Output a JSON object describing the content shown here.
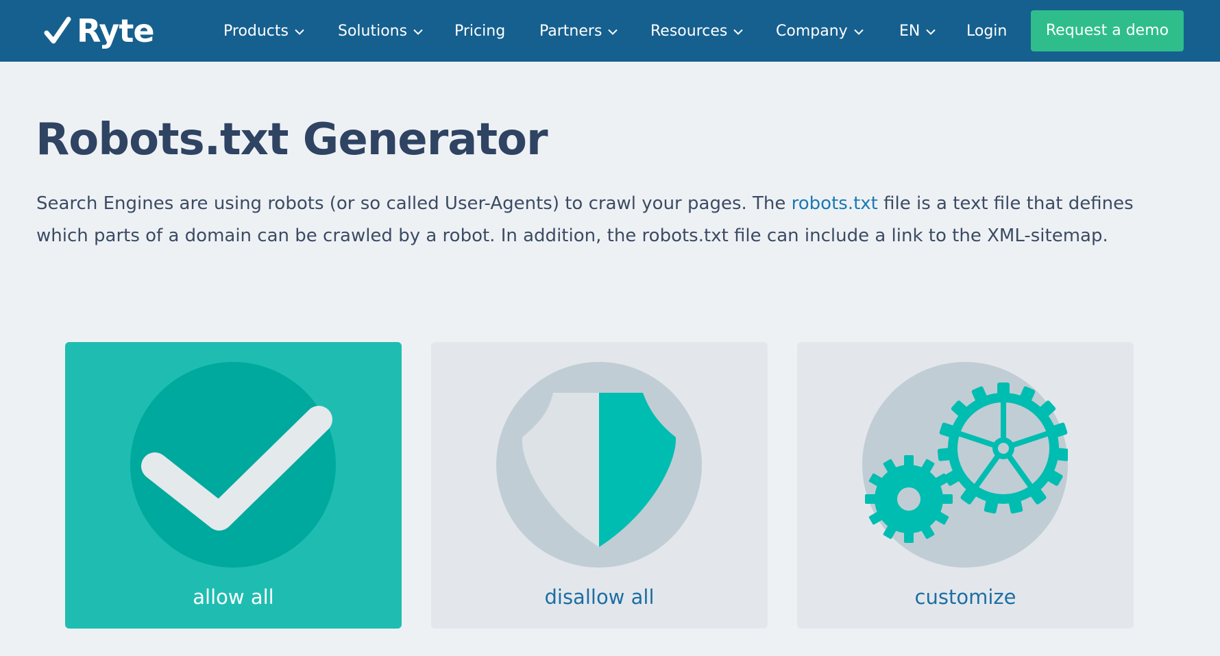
{
  "brand": {
    "name": "Ryte",
    "logo_icon": "checkmark-logo-icon"
  },
  "nav": {
    "items": [
      {
        "label": "Products",
        "has_dropdown": true
      },
      {
        "label": "Solutions",
        "has_dropdown": true
      },
      {
        "label": "Pricing",
        "has_dropdown": false
      },
      {
        "label": "Partners",
        "has_dropdown": true
      },
      {
        "label": "Resources",
        "has_dropdown": true
      },
      {
        "label": "Company",
        "has_dropdown": true
      },
      {
        "label": "EN",
        "has_dropdown": true
      },
      {
        "label": "Login",
        "has_dropdown": false
      }
    ],
    "cta_label": "Request a demo"
  },
  "page": {
    "title": "Robots.txt Generator",
    "intro_before_link": "Search Engines are using robots (or so called User-Agents) to crawl your pages. The ",
    "intro_link": "robots.txt",
    "intro_after_link": " file is a text file that defines which parts of a domain can be crawled by a robot. In addition, the robots.txt file can include a link to the XML-sitemap."
  },
  "options": [
    {
      "label": "allow all",
      "icon": "checkmark-circle-icon",
      "selected": true
    },
    {
      "label": "disallow all",
      "icon": "shield-icon",
      "selected": false
    },
    {
      "label": "customize",
      "icon": "gears-icon",
      "selected": false
    }
  ],
  "colors": {
    "nav_background": "#16608f",
    "cta_background": "#2fbe8b",
    "page_background": "#eef1f4",
    "selected_card": "#1fbdb1",
    "card_background": "#e3e7ec",
    "accent_teal": "#00bdb1",
    "link": "#1b78b4",
    "heading": "#2f4362"
  }
}
